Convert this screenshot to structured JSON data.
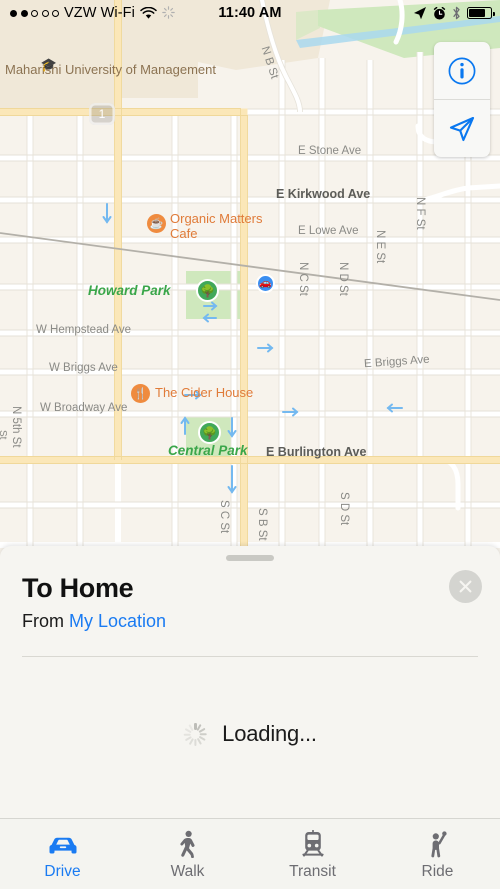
{
  "status_bar": {
    "signal_dots_filled": 2,
    "signal_dots_total": 5,
    "carrier": "VZW Wi-Fi",
    "wifi_icon": "wifi-icon",
    "sync_icon": "sync-spinner-icon",
    "time": "11:40 AM",
    "location_icon": "location-arrow-icon",
    "alarm_icon": "alarm-clock-icon",
    "bluetooth_icon": "bluetooth-icon",
    "battery_icon": "battery-icon",
    "battery_percent": 78
  },
  "map": {
    "controls": {
      "info_button": "info-icon",
      "locate_button": "location-arrow-icon"
    },
    "colors": {
      "land": "#f7f3ec",
      "campus": "#f0e8d8",
      "park_green": "#cfe8bd",
      "water": "#a9d8ef",
      "road_minor": "#ffffff",
      "road_major": "#fbe7b8",
      "park_label": "#3aa64a",
      "poi_label": "#e07b39",
      "street_label": "#8a8a86",
      "oneway_arrow": "#74b9f0",
      "accent_blue": "#1a7bf2"
    },
    "highway_shield": "1",
    "places": [
      {
        "name": "Maharishi University of Management",
        "icon": "graduation-cap-icon",
        "type": "campus"
      },
      {
        "name": "Organic Matters Cafe",
        "icon": "coffee-cup-icon",
        "type": "cafe"
      },
      {
        "name": "The Cider House",
        "icon": "restaurant-fork-knife-icon",
        "type": "restaurant"
      },
      {
        "name": "Howard Park",
        "icon": "tree-icon",
        "type": "park"
      },
      {
        "name": "Central Park",
        "icon": "tree-icon",
        "type": "park"
      },
      {
        "name": "parking-poi",
        "icon": "car-icon",
        "type": "drive"
      }
    ],
    "streets_horizontal": [
      "E Stone Ave",
      "E Kirkwood Ave",
      "E Lowe Ave",
      "W Hempstead Ave",
      "W Briggs Ave",
      "E Briggs Ave",
      "W Broadway Ave",
      "E Burlington Ave"
    ],
    "streets_vertical": [
      "N B St",
      "N C St",
      "N D St",
      "N E St",
      "N F St",
      "N 5th St",
      "S D St",
      "S C St",
      "S B St"
    ]
  },
  "sheet": {
    "destination_title": "To Home",
    "origin_prefix": "From",
    "origin_value": "My Location",
    "close_button": "close-icon",
    "drag_handle": "drag-handle",
    "loading_text": "Loading...",
    "spinner": "activity-spinner-icon"
  },
  "tab_bar": {
    "active": "Drive",
    "tabs": [
      {
        "label": "Drive",
        "icon": "car-icon"
      },
      {
        "label": "Walk",
        "icon": "pedestrian-icon"
      },
      {
        "label": "Transit",
        "icon": "train-icon"
      },
      {
        "label": "Ride",
        "icon": "hailing-person-icon"
      }
    ]
  }
}
